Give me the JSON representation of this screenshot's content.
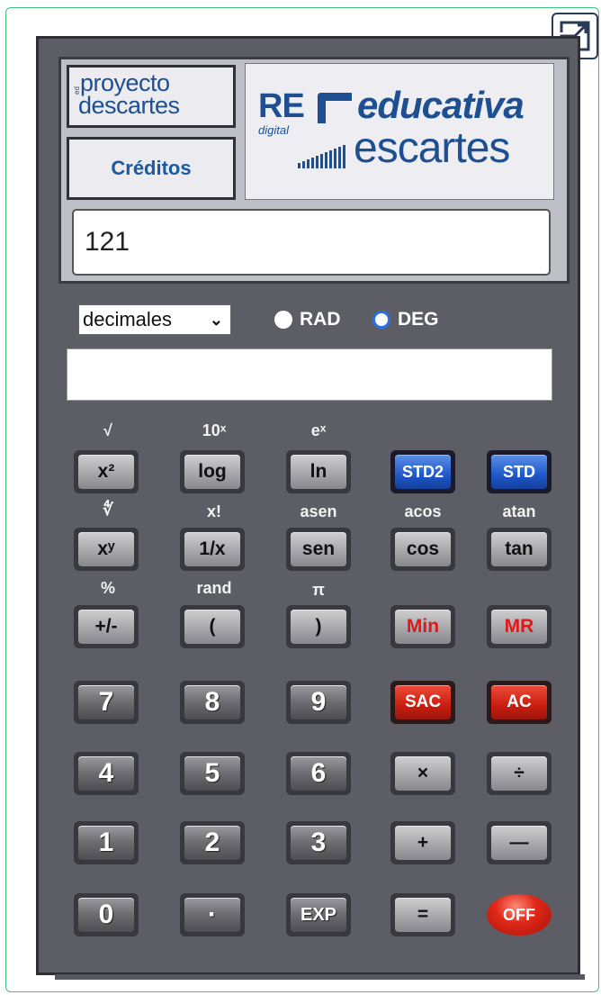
{
  "header": {
    "proyecto_line1": "proyecto",
    "proyecto_line2": "descartes",
    "proyecto_small": "ed",
    "creditos": "Créditos",
    "red_re": "RE",
    "red_educativa": "educativa",
    "red_digital": "digital",
    "red_descartes": "escartes",
    "display_value": "121"
  },
  "controls": {
    "format_select": "decimales",
    "rad_label": "RAD",
    "deg_label": "DEG",
    "angle_mode": "DEG"
  },
  "memory_display": "",
  "secondary_labels": {
    "row1": [
      "√",
      "10ˣ",
      "eˣ"
    ],
    "row2": [
      "∜",
      "x!",
      "asen",
      "acos",
      "atan"
    ],
    "row3": [
      "%",
      "rand",
      "π"
    ]
  },
  "buttons": {
    "row1": [
      "x²",
      "log",
      "ln",
      "STD2",
      "STD"
    ],
    "row2": [
      "xʸ",
      "1/x",
      "sen",
      "cos",
      "tan"
    ],
    "row3": [
      "+/-",
      "(",
      ")",
      "Min",
      "MR"
    ],
    "row4": [
      "7",
      "8",
      "9",
      "SAC",
      "AC"
    ],
    "row5": [
      "4",
      "5",
      "6",
      "×",
      "÷"
    ],
    "row6": [
      "1",
      "2",
      "3",
      "+",
      "—"
    ],
    "row7": [
      "0",
      "·",
      "EXP",
      "=",
      "OFF"
    ]
  },
  "colors": {
    "frame_border": "#3cc47c",
    "body": "#5d5d65",
    "logo_blue": "#1d4f91",
    "std_blue": "#1f58c9",
    "clear_red": "#c81e10",
    "memory_text_red": "#e01818"
  }
}
